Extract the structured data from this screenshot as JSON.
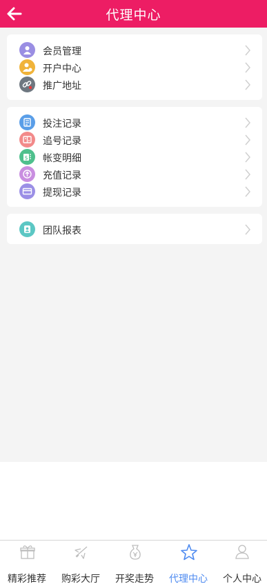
{
  "header": {
    "title": "代理中心"
  },
  "groups": [
    {
      "items": [
        {
          "label": "会员管理",
          "icon": "members-icon",
          "color": "#9a8ee3"
        },
        {
          "label": "开户中心",
          "icon": "open-account-icon",
          "color": "#f0b33a"
        },
        {
          "label": "推广地址",
          "icon": "link-icon",
          "color": "#6e7780"
        }
      ]
    },
    {
      "items": [
        {
          "label": "投注记录",
          "icon": "bet-record-icon",
          "color": "#5a9ee8"
        },
        {
          "label": "追号记录",
          "icon": "chase-number-icon",
          "color": "#f28a8a"
        },
        {
          "label": "帐变明细",
          "icon": "account-change-icon",
          "color": "#4fc08d"
        },
        {
          "label": "充值记录",
          "icon": "recharge-icon",
          "color": "#c98ee0"
        },
        {
          "label": "提现记录",
          "icon": "withdraw-icon",
          "color": "#9b8fe6"
        }
      ]
    },
    {
      "items": [
        {
          "label": "团队报表",
          "icon": "team-report-icon",
          "color": "#5cc7c4"
        }
      ]
    }
  ],
  "tabs": [
    {
      "label": "精彩推荐",
      "icon": "gift-icon",
      "active": false
    },
    {
      "label": "购彩大厅",
      "icon": "plane-icon",
      "active": false
    },
    {
      "label": "开奖走势",
      "icon": "trophy-icon",
      "active": false
    },
    {
      "label": "代理中心",
      "icon": "star-icon",
      "active": true
    },
    {
      "label": "个人中心",
      "icon": "user-icon",
      "active": false
    }
  ],
  "colors": {
    "brand": "#ed1d64",
    "active_tab": "#4d8af0",
    "background": "#f4f4f4"
  }
}
